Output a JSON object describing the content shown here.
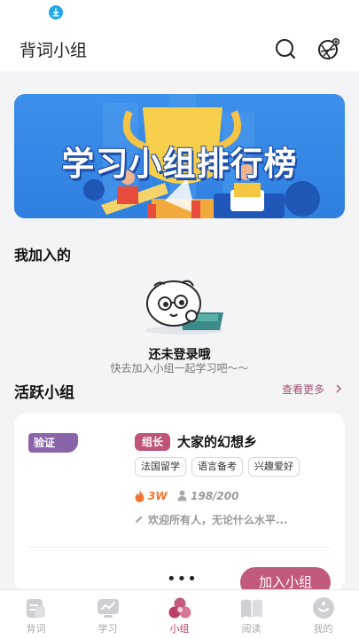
{
  "colors": {
    "accent": "#c25a7e",
    "accent_dark": "#bf5479",
    "verify": "#8a64a8",
    "fire": "#f07535",
    "banner": "#3d90ea"
  },
  "statusbar": {
    "icon": "download-icon"
  },
  "appbar": {
    "title": "背词小组",
    "icons": [
      "search-icon",
      "camera-icon"
    ]
  },
  "banner": {
    "title": "学习小组排行榜"
  },
  "joined": {
    "title": "我加入的",
    "empty_title": "还未登录哦",
    "empty_subtitle": "快去加入小组一起学习吧～～"
  },
  "active": {
    "title": "活跃小组",
    "more": "查看更多"
  },
  "card": {
    "verify_badge": "验证",
    "leader_badge": "组长",
    "name": "大家的幻想乡",
    "tags": [
      "法国留学",
      "语言备考",
      "兴趣爱好"
    ],
    "heat": "3W",
    "members": "198/200",
    "description": "欢迎所有人，无论什么水平...",
    "more_dots": "•••",
    "join_label": "加入小组"
  },
  "tabs": [
    {
      "label": "背词",
      "icon": "book-icon",
      "active": false
    },
    {
      "label": "学习",
      "icon": "chart-board-icon",
      "active": false
    },
    {
      "label": "小组",
      "icon": "group-icon",
      "active": true
    },
    {
      "label": "阅读",
      "icon": "open-book-icon",
      "active": false
    },
    {
      "label": "我的",
      "icon": "profile-icon",
      "active": false
    }
  ]
}
